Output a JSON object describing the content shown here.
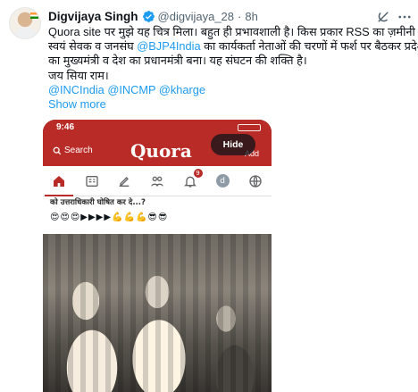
{
  "tweet": {
    "author_name": "Digvijaya Singh",
    "handle": "@digvijaya_28",
    "separator": "·",
    "time": "8h",
    "text_lines": [
      "Quora site पर मुझे यह चित्र मिला। बहुत ही प्रभावशाली है। किस प्रकार RSS का ज़मीनी",
      "स्वयं सेवक व जनसंघ",
      "का मुख्यमंत्री व देश का प्रधानमंत्री बना। यह संघटन की शक्ति है।",
      "जय सिया राम।"
    ],
    "line2_mention": "@BJP4India",
    "line2_tail": "का कार्यकर्ता नेताओं की चरणों में फर्श पर बैठकर प्रदेश",
    "mentions_line": "@INCIndia @INCMP @kharge",
    "show_more": "Show more",
    "icons": {
      "verified": "verified-badge-icon",
      "grok": "grok-icon",
      "more": "more-options-icon"
    },
    "accent_color": "#1d9bf0"
  },
  "media": {
    "hide_label": "Hide",
    "phone_time": "9:46",
    "quora": {
      "brand_color": "#b92b27",
      "search_label": "Search",
      "logo": "Quora",
      "add_label": "Add",
      "nav_icons": [
        "home-icon",
        "following-icon",
        "answer-icon",
        "spaces-icon",
        "notifications-icon",
        "profile-icon",
        "languages-icon"
      ],
      "notification_count": "9",
      "profile_initial": "d",
      "question": "को उत्तराधिकारी घोषित कर दे...?",
      "emojis": "😍😍😍▶▶▶▶💪💪💪😎😎"
    }
  }
}
